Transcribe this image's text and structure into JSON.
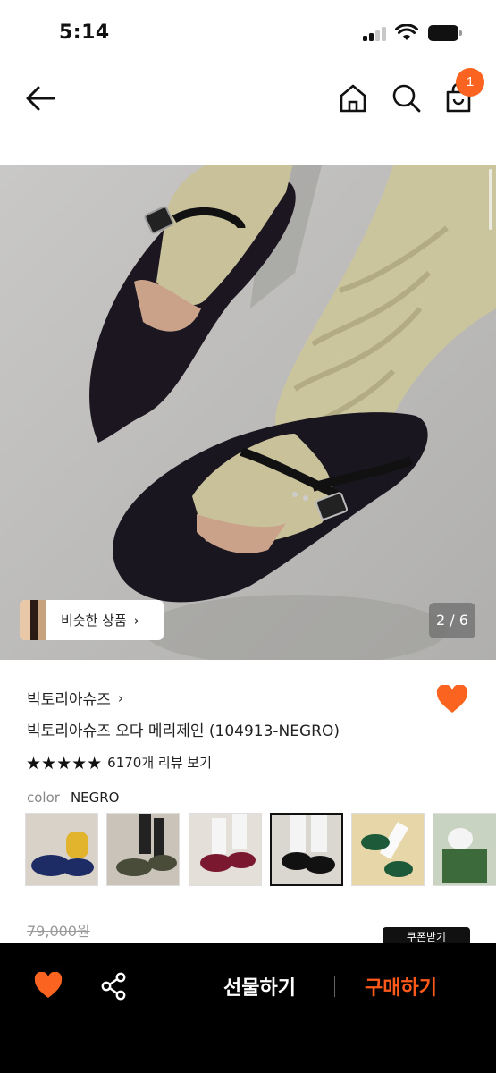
{
  "status_bar": {
    "time": "5:14"
  },
  "header": {
    "cart_count": "1"
  },
  "gallery": {
    "similar_label": "비슷한 상품",
    "page_indicator": "2 / 6"
  },
  "product": {
    "brand": "빅토리아슈즈",
    "name": "빅토리아슈즈 오다 메리제인 (104913-NEGRO)",
    "rating_stars": 5,
    "stars_text": "★★★★★",
    "review_link": "6170개 리뷰 보기",
    "color_label": "color",
    "color_value": "NEGRO",
    "original_price": "79,000원",
    "coupon_label": "쿠폰받기"
  },
  "bottom_bar": {
    "gift_label": "선물하기",
    "buy_label": "구매하기"
  },
  "colors": {
    "accent": "#fa6420",
    "buy_text": "#ff5a1a",
    "bottom_bar_bg": "#000000"
  },
  "icons": {
    "back": "arrow-left-icon",
    "home": "home-icon",
    "search": "search-icon",
    "cart": "shopping-bag-icon",
    "wishlist": "heart-icon",
    "share": "share-icon",
    "chevron": "chevron-right-icon"
  }
}
